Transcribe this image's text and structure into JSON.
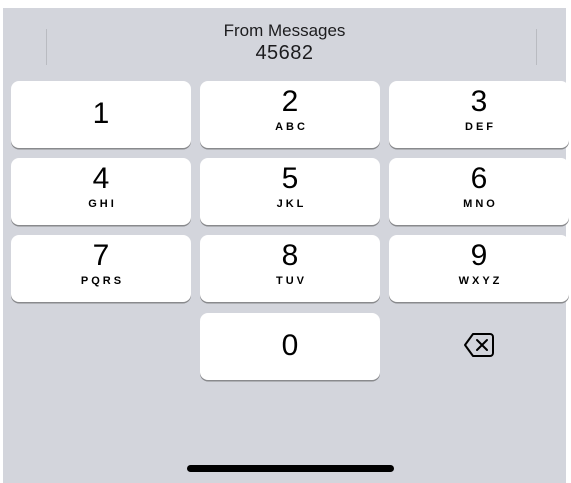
{
  "suggestion": {
    "source": "From Messages",
    "code": "45682"
  },
  "keys": [
    {
      "digit": "1",
      "letters": ""
    },
    {
      "digit": "2",
      "letters": "ABC"
    },
    {
      "digit": "3",
      "letters": "DEF"
    },
    {
      "digit": "4",
      "letters": "GHI"
    },
    {
      "digit": "5",
      "letters": "JKL"
    },
    {
      "digit": "6",
      "letters": "MNO"
    },
    {
      "digit": "7",
      "letters": "PQRS"
    },
    {
      "digit": "8",
      "letters": "TUV"
    },
    {
      "digit": "9",
      "letters": "WXYZ"
    },
    {
      "digit": "0",
      "letters": ""
    }
  ],
  "delete_icon": "backspace-icon",
  "colors": {
    "keyboard_background": "#d3d5dc",
    "key_background": "#ffffff",
    "key_shadow": "#898a8d",
    "text": "#000000"
  }
}
